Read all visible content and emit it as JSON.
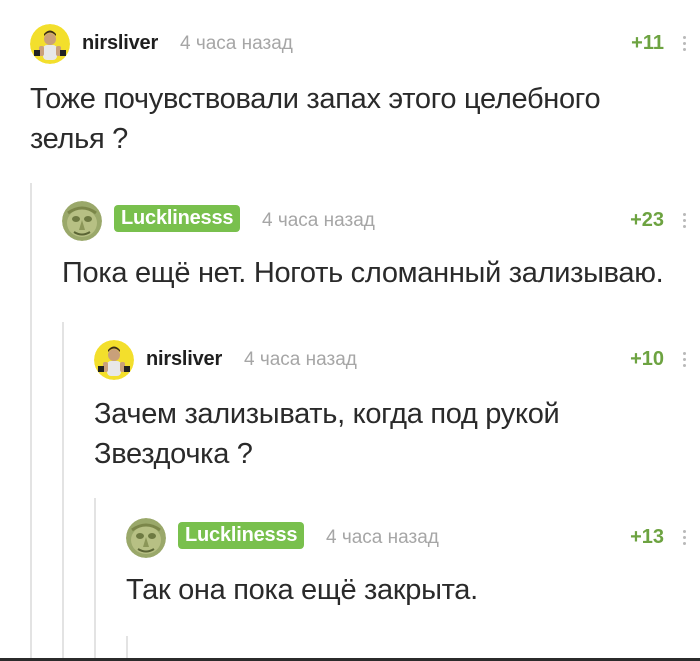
{
  "comments": [
    {
      "username": "nirsliver",
      "time": "4 часа назад",
      "rating": "+11",
      "text_lines": [
        "Тоже почувствовали запах этого целебного",
        "зелья ?"
      ],
      "avatar": "avatar-nirsliver"
    },
    {
      "username": "Lucklinesss",
      "time": "4 часа назад",
      "rating": "+23",
      "text_lines": [
        "Пока ещё нет. Ноготь сломанный зализываю."
      ],
      "avatar": "avatar-lucklinesss"
    },
    {
      "username": "nirsliver",
      "time": "4 часа назад",
      "rating": "+10",
      "text_lines": [
        "Зачем зализывать, когда под рукой",
        "Звездочка ?"
      ],
      "avatar": "avatar-nirsliver"
    },
    {
      "username": "Lucklinesss",
      "time": "4 часа назад",
      "rating": "+13",
      "text_lines": [
        "Так она пока ещё закрыта."
      ],
      "avatar": "avatar-lucklinesss"
    }
  ],
  "colors": {
    "accent_green": "#79c04d",
    "rating_green": "#6da341",
    "muted_gray": "#a6a6a6",
    "thread_line": "#e3e3e3"
  }
}
